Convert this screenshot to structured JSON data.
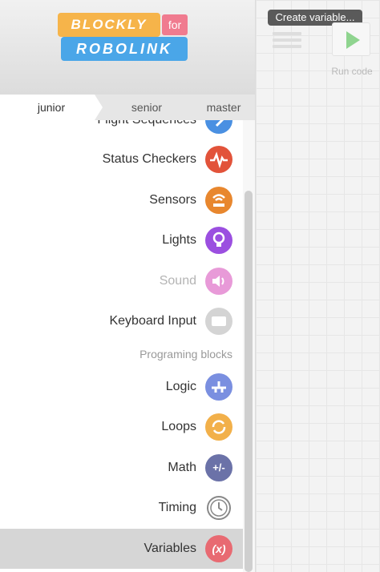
{
  "logo": {
    "top_text": "BLOCKLY",
    "for_text": "for",
    "bottom_text": "ROBOLINK"
  },
  "tabs": [
    {
      "label": "junior",
      "active": true
    },
    {
      "label": "senior",
      "active": false
    },
    {
      "label": "master",
      "active": false
    }
  ],
  "categories": [
    {
      "label": "Flight Sequences",
      "icon": "arrow-right-icon",
      "color": "#4a90e2"
    },
    {
      "label": "Status Checkers",
      "icon": "pulse-icon",
      "color": "#e2533a"
    },
    {
      "label": "Sensors",
      "icon": "sensor-icon",
      "color": "#e8872e"
    },
    {
      "label": "Lights",
      "icon": "lightbulb-icon",
      "color": "#9b4fe0"
    },
    {
      "label": "Sound",
      "icon": "speaker-icon",
      "color": "#e89ad8",
      "disabled": true
    },
    {
      "label": "Keyboard Input",
      "icon": "keyboard-icon",
      "color": "#d4d4d4"
    }
  ],
  "section_label": "Programing blocks",
  "programming_categories": [
    {
      "label": "Logic",
      "icon": "logic-icon",
      "color": "#7a8fe0"
    },
    {
      "label": "Loops",
      "icon": "loop-icon",
      "color": "#f2b04a"
    },
    {
      "label": "Math",
      "icon": "math-icon",
      "color": "#6b72a8",
      "glyph": "+/-"
    },
    {
      "label": "Timing",
      "icon": "clock-icon",
      "color": "#ffffff"
    },
    {
      "label": "Variables",
      "icon": "variable-icon",
      "color": "#e86a72",
      "glyph": "(x)",
      "selected": true
    }
  ],
  "workspace": {
    "create_variable_label": "Create variable...",
    "run_label": "Run code"
  }
}
